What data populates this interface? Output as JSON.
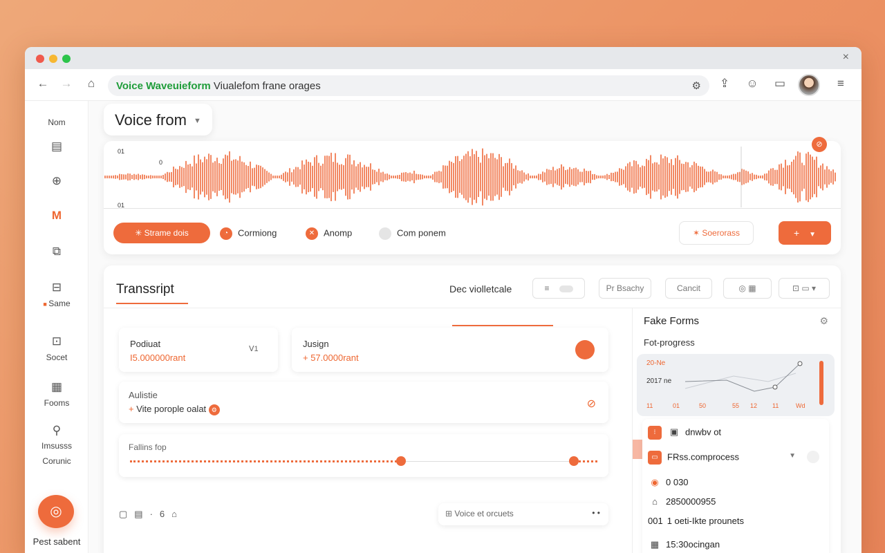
{
  "browser": {
    "address_highlight": "Voice Waveuieform",
    "address_rest": "Viualefom frane orages",
    "icons": [
      "back-icon",
      "forward-icon",
      "home-icon",
      "extension-icon",
      "share-icon",
      "sync-icon",
      "folder-icon",
      "menu-icon"
    ]
  },
  "sidebar": {
    "header": "Nom",
    "items": [
      {
        "label": "",
        "icon": "document-icon"
      },
      {
        "label": "",
        "icon": "lock-icon"
      },
      {
        "label": "",
        "icon": "mail-icon"
      },
      {
        "label": "",
        "icon": "copy-icon"
      },
      {
        "label": "Same",
        "icon": "briefcase-icon"
      },
      {
        "label": "Socet",
        "icon": "bag-icon"
      },
      {
        "label": "Fooms",
        "icon": "form-icon"
      },
      {
        "label": "Imsusss Corunic",
        "icon": "filter-icon"
      }
    ],
    "fab_label": "Pest sabent"
  },
  "main": {
    "title": "Voice from",
    "waveform": {
      "y_top": "01",
      "y_mid": "0",
      "y_bottom": "01",
      "accent": "#ee6b3c"
    },
    "controls": {
      "primary": "Strame dois",
      "options": [
        "Cormiong",
        "Anomp",
        "Com ponem"
      ],
      "outline_button": "Soerorass",
      "fill_button": "+"
    }
  },
  "transcript": {
    "title": "Transsript",
    "selector": "Dec violletcale",
    "toolbar": {
      "filter": "≡",
      "btn1": "Pr Bsachy",
      "btn2": "Cancit"
    },
    "cards": [
      {
        "label": "Podiuat",
        "value": "I5.000000rant",
        "badge": "ᐯ1"
      },
      {
        "label": "Jusign",
        "value": "+ 57.0000rant"
      }
    ],
    "availability": {
      "label": "Aulistie",
      "value": "Vite porople oalat"
    },
    "slider": {
      "label": "Fallins fop",
      "position": 0.58,
      "end_position": 0.95
    },
    "search_placeholder": "Voice et orcuets"
  },
  "right_panel": {
    "title": "Fake Forms",
    "subtitle": "Fot-progress",
    "chart": {
      "label_1": "20-Ne",
      "label_2": "2017 ne",
      "ticks": [
        "11",
        "01",
        "50",
        "55",
        "12",
        "11",
        "Wd"
      ]
    },
    "list": [
      {
        "text": "dnwbv ot",
        "icon": "checklist-icon"
      },
      {
        "text": "FRss.comprocess",
        "icon": "dropdown-icon"
      },
      {
        "text": "0 030",
        "icon": "target-icon"
      },
      {
        "text": "2850000955",
        "icon": "car-icon"
      },
      {
        "text": "1 oeti-Ikte prounets",
        "icon": "number-icon",
        "prefix": "001"
      },
      {
        "text": "15:30ocingan",
        "icon": "calendar-icon"
      }
    ]
  }
}
